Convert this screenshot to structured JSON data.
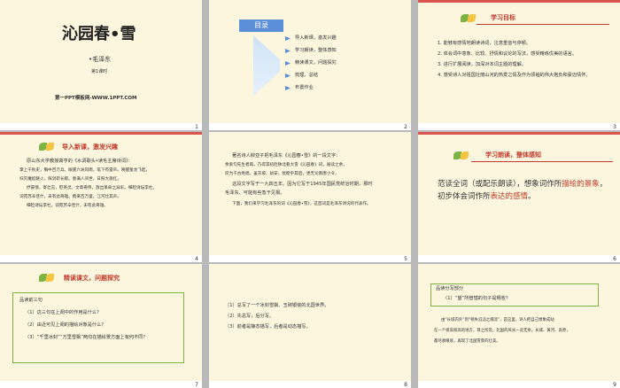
{
  "slides": [
    {
      "num": "1",
      "title": "沁园春•雪",
      "author": "•毛泽东",
      "lesson": "第1课时",
      "footer": "第一PPT模板网-WWW.1PPT.COM"
    },
    {
      "num": "2",
      "menu_label": "目录",
      "items": [
        "导入新课，激发兴趣",
        "学习朗读，整体感知",
        "精读课文，问题探究",
        "梳理、总结",
        "布置作业"
      ]
    },
    {
      "num": "3",
      "heading": "学习目标",
      "goals": [
        "1. 能够有感情地朗读诗词，注意重音与停顿。",
        "2. 体会词中意象、比较、抒情和议论的写法，感受精练优美的语言。",
        "3. 进行扩展阅读，加深对本词主题的理解。",
        "4. 感受诗人对祖国壮丽山河的热爱之情及作为领袖的伟大抱负和豪迈情怀。"
      ]
    },
    {
      "num": "4",
      "heading": "导入新课，激发兴趣",
      "lines": [
        "原山东大学教授高亨的《水调歌头•读毛主席诗词》：",
        "掌上千秋史，胸中百万兵。眼底六洲风雨，笔下有雷声。唤醒蛰龙飞起，",
        "扫灭魔焰魅火，挥剑斩长鲸。春满人间世，日照大旗红。",
        "抒豪情，寄壮志，慰英灵。文章奇伟，放出革命之异彩。细检诗坛李杜，",
        "词苑苏辛佳什，未有此奇雄。携来百万里，江河壮其声。",
        "细检诗坛李杜，词苑苏辛佳什，未有此奇雄。"
      ]
    },
    {
      "num": "5",
      "lines": [
        "著名诗人柳亚子把毛泽东《沁园春•雪》的一段文字：",
        "余索句先生者再，乃得其初赴陕北看大雪《沁园春》词，展读之余，",
        "叹为千古绝唱，虽东坡、幼安，犹瞠乎其后，更无论南唐小令，",
        "这段文字写于一九四五年。因为它写于1945年国民党统治时期，那时",
        "毛泽东、可能有些急于见报。",
        "下面，我们来学习毛泽东的词《沁园春•雪》，这首词是毛泽东诗词的代表作。"
      ]
    },
    {
      "num": "6",
      "heading": "学习朗读，整体感知",
      "body_a": "范读全词（或配乐朗读），想象词作所",
      "body_b": "描绘的景象",
      "body_c": "，初步体会词作所",
      "body_d": "表达的感情",
      "body_e": "。"
    },
    {
      "num": "7",
      "heading": "精读课文，问题探究",
      "box_title": "品读前三句",
      "qs": [
        "（1）这三句在上阕中的作用是什么？",
        "（2）由近可见上阕的描绘对象是什么？",
        "（3）“千里冰封”“万里雪飘”两句在描绘景方面上有何不同？"
      ]
    },
    {
      "num": "8",
      "lines": [
        "（1）总写了一个冰封雪飘、玉砌银装的北国世界。",
        "（2）先总写，后分写。",
        "（3）前者是静态描写，后者是动态描写。"
      ]
    },
    {
      "num": "9",
      "box_title": "品读分写部分",
      "box_q": "（1）“望”所管辖的句子是哪些？",
      "answer": [
        "由“长城内外”到“顿失滔滔之瀚流”，是这里，诗人把自己想象成站",
        "在一个很高很高的地方，目之所及，北国的风光一览无余。长城、黄河、高原，",
        "都尽收眼底，再现了北国雪景的壮美。"
      ]
    }
  ],
  "colors": {
    "accent": "#c0392b",
    "leaf_green": "#7cb342",
    "leaf_yellow": "#f4c542",
    "menu_blue": "#5b8fd8"
  }
}
